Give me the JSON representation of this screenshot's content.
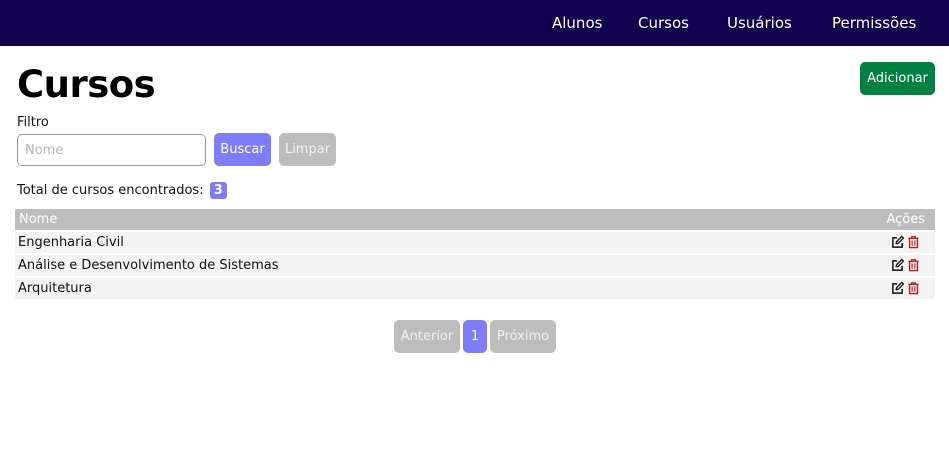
{
  "nav": {
    "items": [
      "Alunos",
      "Cursos",
      "Usuários",
      "Permissões"
    ]
  },
  "page": {
    "title": "Cursos",
    "add_label": "Adicionar"
  },
  "filter": {
    "label": "Filtro",
    "placeholder": "Nome",
    "value": "",
    "search_label": "Buscar",
    "clear_label": "Limpar"
  },
  "summary": {
    "total_label": "Total de cursos encontrados:",
    "count": "3"
  },
  "table": {
    "headers": {
      "name": "Nome",
      "actions": "Ações"
    },
    "rows": [
      {
        "name": "Engenharia Civil"
      },
      {
        "name": "Análise e Desenvolvimento de Sistemas"
      },
      {
        "name": "Arquitetura"
      }
    ],
    "row_icons": [
      "edit-icon",
      "trash-icon"
    ]
  },
  "pagination": {
    "prev_label": "Anterior",
    "current_page": "1",
    "next_label": "Próximo"
  },
  "colors": {
    "navbar": "#12004f",
    "primary": "#7d7df7",
    "success": "#008142",
    "disabled": "#bdbdbd",
    "danger": "#b21f1f"
  }
}
